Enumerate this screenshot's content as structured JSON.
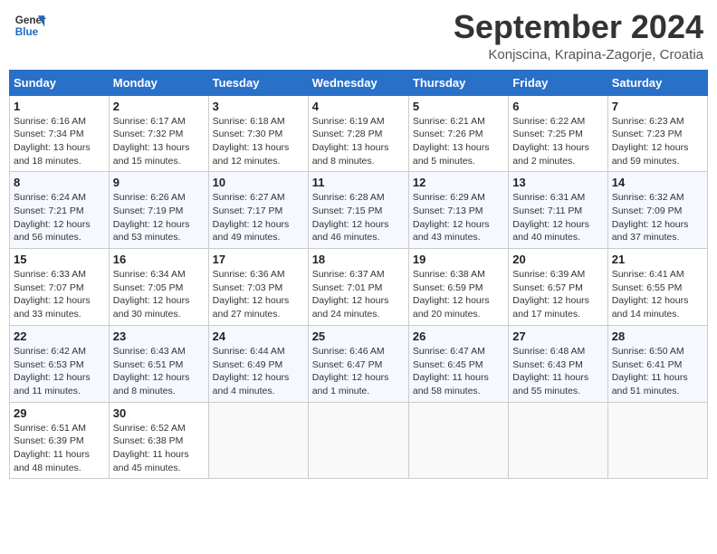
{
  "header": {
    "logo_general": "General",
    "logo_blue": "Blue",
    "month_title": "September 2024",
    "location": "Konjscina, Krapina-Zagorje, Croatia"
  },
  "days_of_week": [
    "Sunday",
    "Monday",
    "Tuesday",
    "Wednesday",
    "Thursday",
    "Friday",
    "Saturday"
  ],
  "weeks": [
    [
      {
        "day": "1",
        "info": "Sunrise: 6:16 AM\nSunset: 7:34 PM\nDaylight: 13 hours and 18 minutes."
      },
      {
        "day": "2",
        "info": "Sunrise: 6:17 AM\nSunset: 7:32 PM\nDaylight: 13 hours and 15 minutes."
      },
      {
        "day": "3",
        "info": "Sunrise: 6:18 AM\nSunset: 7:30 PM\nDaylight: 13 hours and 12 minutes."
      },
      {
        "day": "4",
        "info": "Sunrise: 6:19 AM\nSunset: 7:28 PM\nDaylight: 13 hours and 8 minutes."
      },
      {
        "day": "5",
        "info": "Sunrise: 6:21 AM\nSunset: 7:26 PM\nDaylight: 13 hours and 5 minutes."
      },
      {
        "day": "6",
        "info": "Sunrise: 6:22 AM\nSunset: 7:25 PM\nDaylight: 13 hours and 2 minutes."
      },
      {
        "day": "7",
        "info": "Sunrise: 6:23 AM\nSunset: 7:23 PM\nDaylight: 12 hours and 59 minutes."
      }
    ],
    [
      {
        "day": "8",
        "info": "Sunrise: 6:24 AM\nSunset: 7:21 PM\nDaylight: 12 hours and 56 minutes."
      },
      {
        "day": "9",
        "info": "Sunrise: 6:26 AM\nSunset: 7:19 PM\nDaylight: 12 hours and 53 minutes."
      },
      {
        "day": "10",
        "info": "Sunrise: 6:27 AM\nSunset: 7:17 PM\nDaylight: 12 hours and 49 minutes."
      },
      {
        "day": "11",
        "info": "Sunrise: 6:28 AM\nSunset: 7:15 PM\nDaylight: 12 hours and 46 minutes."
      },
      {
        "day": "12",
        "info": "Sunrise: 6:29 AM\nSunset: 7:13 PM\nDaylight: 12 hours and 43 minutes."
      },
      {
        "day": "13",
        "info": "Sunrise: 6:31 AM\nSunset: 7:11 PM\nDaylight: 12 hours and 40 minutes."
      },
      {
        "day": "14",
        "info": "Sunrise: 6:32 AM\nSunset: 7:09 PM\nDaylight: 12 hours and 37 minutes."
      }
    ],
    [
      {
        "day": "15",
        "info": "Sunrise: 6:33 AM\nSunset: 7:07 PM\nDaylight: 12 hours and 33 minutes."
      },
      {
        "day": "16",
        "info": "Sunrise: 6:34 AM\nSunset: 7:05 PM\nDaylight: 12 hours and 30 minutes."
      },
      {
        "day": "17",
        "info": "Sunrise: 6:36 AM\nSunset: 7:03 PM\nDaylight: 12 hours and 27 minutes."
      },
      {
        "day": "18",
        "info": "Sunrise: 6:37 AM\nSunset: 7:01 PM\nDaylight: 12 hours and 24 minutes."
      },
      {
        "day": "19",
        "info": "Sunrise: 6:38 AM\nSunset: 6:59 PM\nDaylight: 12 hours and 20 minutes."
      },
      {
        "day": "20",
        "info": "Sunrise: 6:39 AM\nSunset: 6:57 PM\nDaylight: 12 hours and 17 minutes."
      },
      {
        "day": "21",
        "info": "Sunrise: 6:41 AM\nSunset: 6:55 PM\nDaylight: 12 hours and 14 minutes."
      }
    ],
    [
      {
        "day": "22",
        "info": "Sunrise: 6:42 AM\nSunset: 6:53 PM\nDaylight: 12 hours and 11 minutes."
      },
      {
        "day": "23",
        "info": "Sunrise: 6:43 AM\nSunset: 6:51 PM\nDaylight: 12 hours and 8 minutes."
      },
      {
        "day": "24",
        "info": "Sunrise: 6:44 AM\nSunset: 6:49 PM\nDaylight: 12 hours and 4 minutes."
      },
      {
        "day": "25",
        "info": "Sunrise: 6:46 AM\nSunset: 6:47 PM\nDaylight: 12 hours and 1 minute."
      },
      {
        "day": "26",
        "info": "Sunrise: 6:47 AM\nSunset: 6:45 PM\nDaylight: 11 hours and 58 minutes."
      },
      {
        "day": "27",
        "info": "Sunrise: 6:48 AM\nSunset: 6:43 PM\nDaylight: 11 hours and 55 minutes."
      },
      {
        "day": "28",
        "info": "Sunrise: 6:50 AM\nSunset: 6:41 PM\nDaylight: 11 hours and 51 minutes."
      }
    ],
    [
      {
        "day": "29",
        "info": "Sunrise: 6:51 AM\nSunset: 6:39 PM\nDaylight: 11 hours and 48 minutes."
      },
      {
        "day": "30",
        "info": "Sunrise: 6:52 AM\nSunset: 6:38 PM\nDaylight: 11 hours and 45 minutes."
      },
      {
        "day": "",
        "info": ""
      },
      {
        "day": "",
        "info": ""
      },
      {
        "day": "",
        "info": ""
      },
      {
        "day": "",
        "info": ""
      },
      {
        "day": "",
        "info": ""
      }
    ]
  ]
}
